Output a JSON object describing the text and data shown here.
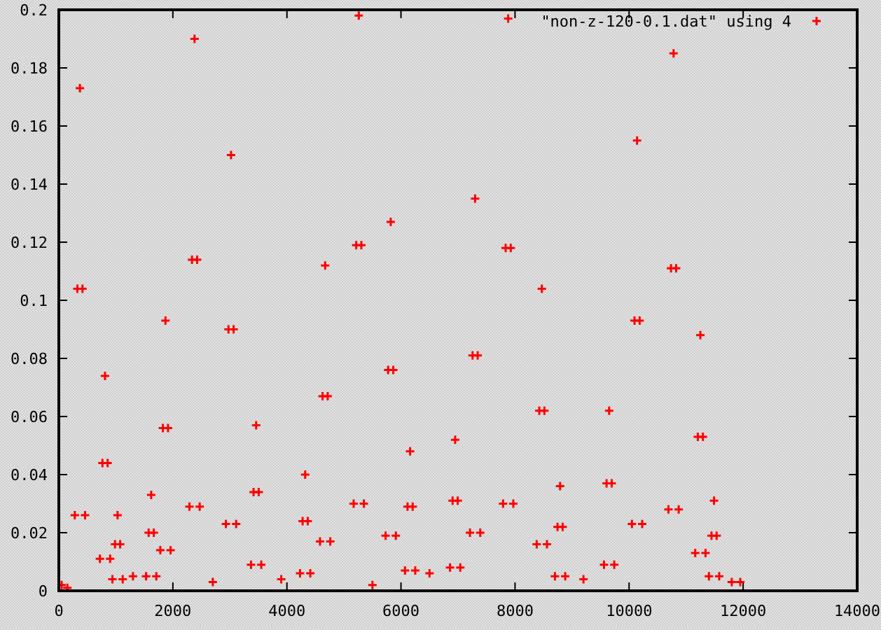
{
  "chart_data": {
    "type": "scatter",
    "xlim": [
      0,
      14000
    ],
    "ylim": [
      0,
      0.2
    ],
    "xticks": [
      0,
      2000,
      4000,
      6000,
      8000,
      10000,
      12000,
      14000
    ],
    "yticks": [
      0,
      0.02,
      0.04,
      0.06,
      0.08,
      {
        "value": 0.1,
        "label": "0.1"
      },
      0.12,
      0.14,
      0.16,
      0.18,
      {
        "value": 0.2,
        "label": "0.2"
      }
    ],
    "x": [
      280,
      325,
      370,
      415,
      460,
      720,
      765,
      810,
      855,
      900,
      940,
      985,
      1030,
      1075,
      1120,
      1530,
      1575,
      1620,
      1665,
      1710,
      1780,
      1825,
      1870,
      1915,
      1960,
      2290,
      2335,
      2380,
      2425,
      2470,
      2930,
      2975,
      3020,
      3065,
      3110,
      3370,
      3415,
      3460,
      3505,
      3550,
      4230,
      4275,
      4320,
      4365,
      4410,
      4580,
      4625,
      4670,
      4715,
      4760,
      5170,
      5215,
      5260,
      5305,
      5350,
      5730,
      5775,
      5820,
      5865,
      5910,
      6070,
      6115,
      6160,
      6205,
      6250,
      6860,
      6905,
      6950,
      6995,
      7040,
      7210,
      7255,
      7300,
      7345,
      7390,
      7790,
      7835,
      7880,
      7925,
      7970,
      8380,
      8425,
      8470,
      8515,
      8560,
      8700,
      8745,
      8790,
      8835,
      8880,
      9560,
      9605,
      9650,
      9695,
      9740,
      10050,
      10095,
      10140,
      10185,
      10230,
      10690,
      10735,
      10780,
      10825,
      10870,
      11160,
      11205,
      11250,
      11295,
      11340,
      11400,
      11445,
      11490,
      11535,
      11580,
      50,
      150,
      1300,
      2700,
      3900,
      5500,
      6500,
      9200,
      11800,
      11950
    ],
    "series": [
      {
        "name": "\"non-z-120-0.1.dat\" using 4",
        "color": "#ff0000",
        "values": [
          0.026,
          0.104,
          0.173,
          0.104,
          0.026,
          0.011,
          0.044,
          0.074,
          0.044,
          0.011,
          0.004,
          0.016,
          0.026,
          0.016,
          0.004,
          0.005,
          0.02,
          0.033,
          0.02,
          0.005,
          0.014,
          0.056,
          0.093,
          0.056,
          0.014,
          0.029,
          0.114,
          0.19,
          0.114,
          0.029,
          0.023,
          0.09,
          0.15,
          0.09,
          0.023,
          0.009,
          0.034,
          0.057,
          0.034,
          0.009,
          0.006,
          0.024,
          0.04,
          0.024,
          0.006,
          0.017,
          0.067,
          0.112,
          0.067,
          0.017,
          0.03,
          0.119,
          0.198,
          0.119,
          0.03,
          0.019,
          0.076,
          0.127,
          0.076,
          0.019,
          0.007,
          0.029,
          0.048,
          0.029,
          0.007,
          0.008,
          0.031,
          0.052,
          0.031,
          0.008,
          0.02,
          0.081,
          0.135,
          0.081,
          0.02,
          0.03,
          0.118,
          0.197,
          0.118,
          0.03,
          0.016,
          0.062,
          0.104,
          0.062,
          0.016,
          0.005,
          0.022,
          0.036,
          0.022,
          0.005,
          0.009,
          0.037,
          0.062,
          0.037,
          0.009,
          0.023,
          0.093,
          0.155,
          0.093,
          0.023,
          0.028,
          0.111,
          0.185,
          0.111,
          0.028,
          0.013,
          0.053,
          0.088,
          0.053,
          0.013,
          0.005,
          0.019,
          0.031,
          0.019,
          0.005,
          0.002,
          0.001,
          0.005,
          0.003,
          0.004,
          0.002,
          0.006,
          0.004,
          0.003,
          0.003
        ]
      }
    ]
  }
}
